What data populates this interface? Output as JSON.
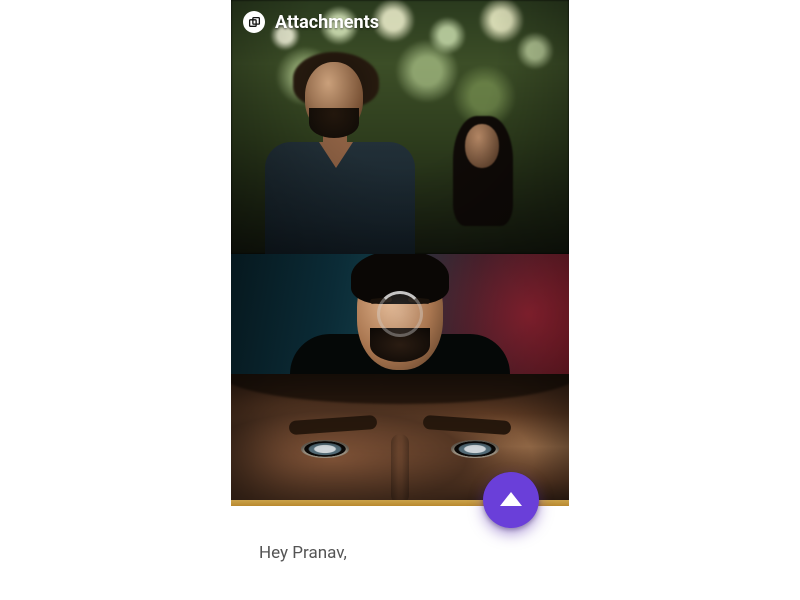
{
  "header": {
    "title": "Attachments",
    "icon": "attachments-icon"
  },
  "gallery": {
    "items": [
      {
        "name": "attachment-photo-1",
        "alt": "Man with curly hair and beard outdoors under green bokeh foliage, second person blurred behind"
      },
      {
        "name": "attachment-photo-2",
        "alt": "Studio headshot of a man with short hair and stubble, teal and red gel lighting"
      },
      {
        "name": "attachment-photo-3",
        "alt": "Extreme close-up of a man's eyes and brow, warm tones"
      }
    ],
    "loading": true
  },
  "panel": {
    "greeting": "Hey Pranav,"
  },
  "fab": {
    "icon": "chevron-up-icon",
    "label": "Expand message"
  },
  "colors": {
    "fab": "#6a3fd9",
    "accentBar": "#b8892f",
    "textMuted": "#545454"
  }
}
